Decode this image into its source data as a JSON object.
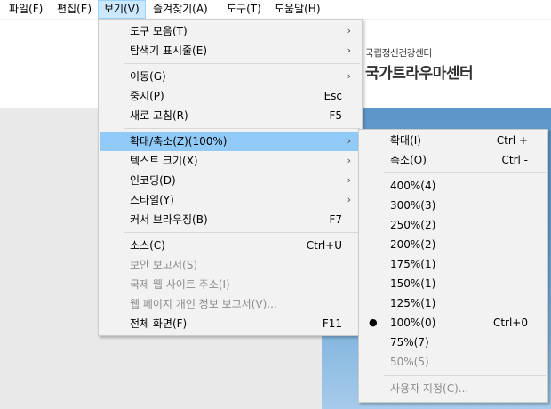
{
  "menubar": {
    "items": [
      {
        "label": "파일(F)"
      },
      {
        "label": "편집(E)"
      },
      {
        "label": "보기(V)"
      },
      {
        "label": "즐겨찾기(A)"
      },
      {
        "label": "도구(T)"
      },
      {
        "label": "도움말(H)"
      }
    ]
  },
  "page": {
    "logo_small": "국립정신건강센터",
    "logo_big": "국가트라우마센터"
  },
  "view_menu": {
    "toolbars": {
      "label": "도구 모음(T)"
    },
    "explorer_bars": {
      "label": "탐색기 표시줄(E)"
    },
    "go_to": {
      "label": "이동(G)"
    },
    "stop": {
      "label": "중지(P)",
      "shortcut": "Esc"
    },
    "refresh": {
      "label": "새로 고침(R)",
      "shortcut": "F5"
    },
    "zoom": {
      "label": "확대/축소(Z)(100%)"
    },
    "text_size": {
      "label": "텍스트 크기(X)"
    },
    "encoding": {
      "label": "인코딩(D)"
    },
    "style": {
      "label": "스타일(Y)"
    },
    "caret_browsing": {
      "label": "커서 브라우징(B)",
      "shortcut": "F7"
    },
    "source": {
      "label": "소스(C)",
      "shortcut": "Ctrl+U"
    },
    "security_report": {
      "label": "보안 보고서(S)"
    },
    "idn_report": {
      "label": "국제 웹 사이트 주소(I)"
    },
    "privacy_report": {
      "label": "웹 페이지 개인 정보 보고서(V)..."
    },
    "full_screen": {
      "label": "전체 화면(F)",
      "shortcut": "F11"
    }
  },
  "zoom_menu": {
    "zoom_in": {
      "label": "확대(I)",
      "shortcut": "Ctrl +"
    },
    "zoom_out": {
      "label": "축소(O)",
      "shortcut": "Ctrl -"
    },
    "z400": {
      "label": "400%(4)"
    },
    "z300": {
      "label": "300%(3)"
    },
    "z250": {
      "label": "250%(2)"
    },
    "z200": {
      "label": "200%(2)"
    },
    "z175": {
      "label": "175%(1)"
    },
    "z150": {
      "label": "150%(1)"
    },
    "z125": {
      "label": "125%(1)"
    },
    "z100": {
      "label": "100%(0)",
      "shortcut": "Ctrl+0",
      "checked": true
    },
    "z75": {
      "label": "75%(7)"
    },
    "z50": {
      "label": "50%(5)"
    },
    "custom": {
      "label": "사용자 지정(C)..."
    }
  },
  "icons": {
    "submenu_arrow": "›",
    "check_bullet": "●"
  },
  "colors": {
    "menu_highlight": "#91c9f7",
    "menubar_active": "#cce8ff",
    "disabled_text": "#8c8c8c"
  }
}
